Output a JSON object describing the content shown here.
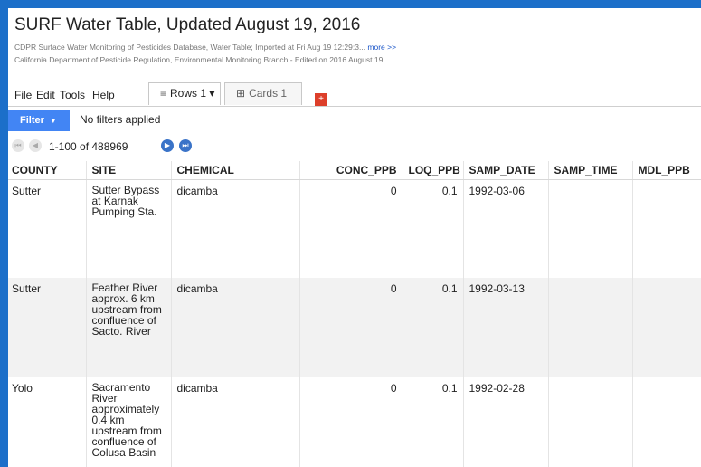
{
  "header": {
    "title": "SURF Water Table, Updated August 19, 2016",
    "description": "CDPR Surface Water Monitoring of Pesticides Database, Water Table; Imported at Fri Aug 19 12:29:3...",
    "more_link": "more >>",
    "attribution": "California Department of Pesticide Regulation, Environmental Monitoring Branch  -  Edited on 2016 August 19"
  },
  "menu": {
    "file": "File",
    "edit": "Edit",
    "tools": "Tools",
    "help": "Help"
  },
  "tabs": [
    {
      "icon": "≡",
      "label": "Rows 1 ▾",
      "active": true
    },
    {
      "icon": "⊞",
      "label": "Cards 1",
      "active": false
    }
  ],
  "add_tab": "+",
  "filter": {
    "label": "Filter",
    "caret": "▼",
    "status": "No filters applied"
  },
  "pager": {
    "text": "1-100 of 488969",
    "first": "⏮",
    "prev": "◀",
    "next": "▶",
    "last": "⏭"
  },
  "table": {
    "columns": [
      "COUNTY",
      "SITE",
      "CHEMICAL",
      "CONC_PPB",
      "LOQ_PPB",
      "SAMP_DATE",
      "SAMP_TIME",
      "MDL_PPB"
    ],
    "rows": [
      {
        "county": "Sutter",
        "site": "Sutter Bypass at Karnak Pumping Sta.",
        "chemical": "dicamba",
        "conc_ppb": "0",
        "loq_ppb": "0.1",
        "samp_date": "1992-03-06",
        "samp_time": "",
        "mdl_ppb": ""
      },
      {
        "county": "Sutter",
        "site": "Feather River approx. 6 km upstream from confluence of Sacto. River",
        "chemical": "dicamba",
        "conc_ppb": "0",
        "loq_ppb": "0.1",
        "samp_date": "1992-03-13",
        "samp_time": "",
        "mdl_ppb": ""
      },
      {
        "county": "Yolo",
        "site": "Sacramento River approximately 0.4 km upstream from confluence of Colusa Basin",
        "chemical": "dicamba",
        "conc_ppb": "0",
        "loq_ppb": "0.1",
        "samp_date": "1992-02-28",
        "samp_time": "",
        "mdl_ppb": ""
      }
    ]
  },
  "colors": {
    "frame": "#1c6fc9",
    "filter_button": "#4285f4",
    "add_tab": "#dd3f2a",
    "link": "#1a55c8"
  }
}
